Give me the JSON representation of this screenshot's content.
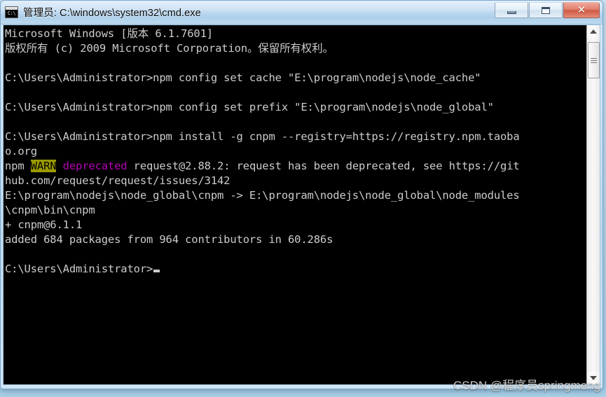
{
  "window": {
    "title": "管理员: C:\\windows\\system32\\cmd.exe",
    "icon": "cmd-console-icon",
    "controls": {
      "minimize_label": "―",
      "maximize_label": "❐",
      "close_label": "✕"
    }
  },
  "console": {
    "background_color": "#000000",
    "foreground_color": "#cccccc",
    "warn_background_color": "#9a9a00",
    "warn_foreground_color": "#000000",
    "magenta_color": "#b500b5",
    "lines": [
      {
        "id": "l01",
        "text": "Microsoft Windows [版本 6.1.7601]"
      },
      {
        "id": "l02",
        "text": "版权所有 (c) 2009 Microsoft Corporation。保留所有权利。"
      },
      {
        "id": "l03",
        "text": ""
      },
      {
        "id": "l04",
        "text": "C:\\Users\\Administrator>npm config set cache \"E:\\program\\nodejs\\node_cache\""
      },
      {
        "id": "l05",
        "text": ""
      },
      {
        "id": "l06",
        "text": "C:\\Users\\Administrator>npm config set prefix \"E:\\program\\nodejs\\node_global\""
      },
      {
        "id": "l07",
        "text": ""
      },
      {
        "id": "l08",
        "text": "C:\\Users\\Administrator>npm install -g cnpm --registry=https://registry.npm.taoba"
      },
      {
        "id": "l09",
        "text": "o.org"
      },
      {
        "id": "l10",
        "segments": [
          {
            "text": "npm ",
            "style": "normal"
          },
          {
            "text": "WARN",
            "style": "warn"
          },
          {
            "text": " ",
            "style": "normal"
          },
          {
            "text": "deprecated",
            "style": "magenta"
          },
          {
            "text": " request@2.88.2: request has been deprecated, see https://git",
            "style": "normal"
          }
        ]
      },
      {
        "id": "l11",
        "text": "hub.com/request/request/issues/3142"
      },
      {
        "id": "l12",
        "text": "E:\\program\\nodejs\\node_global\\cnpm -> E:\\program\\nodejs\\node_global\\node_modules"
      },
      {
        "id": "l13",
        "text": "\\cnpm\\bin\\cnpm"
      },
      {
        "id": "l14",
        "text": "+ cnpm@6.1.1"
      },
      {
        "id": "l15",
        "text": "added 684 packages from 964 contributors in 60.286s"
      },
      {
        "id": "l16",
        "text": ""
      },
      {
        "id": "l17",
        "text": "C:\\Users\\Administrator>",
        "cursor": true
      }
    ]
  },
  "scrollbar": {
    "up_arrow": "scroll-up-arrow",
    "down_arrow": "scroll-down-arrow"
  },
  "watermark": {
    "text": "CSDN @程序员springmeng"
  }
}
